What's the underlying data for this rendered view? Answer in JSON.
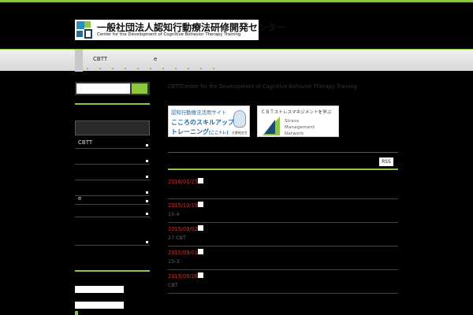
{
  "logo": {
    "title": "一般社団法人認知行動療法研修開発センター",
    "subtitle": "Center for the Development of Cognitive Behavior Therapy Training"
  },
  "nav": {
    "items": [
      "CBTT",
      "e"
    ]
  },
  "sidebar": {
    "rows": [
      "CBTT",
      "",
      "",
      "",
      "e",
      "",
      ""
    ]
  },
  "main": {
    "title": "CBTTCenter for the Development of Cognitive Behavior Therapy Training"
  },
  "banners": {
    "b1_line1": "認知行動療法活用サイト",
    "b1_line2": "こころのスキルアップ・",
    "b1_line3": "トレーニング",
    "b1_line3_small": "[ここトレ]",
    "b1_name": "大野裕先生",
    "b2_title": "ＣＢＴストレスマネジメントを学ぶ",
    "b2_words": [
      "Stress",
      "Management",
      "Network"
    ]
  },
  "rss": "RSS",
  "news": [
    {
      "date": "2016/01/25",
      "text": ""
    },
    {
      "date": "2015/10/19",
      "text": "15-4"
    },
    {
      "date": "2015/09/02",
      "text": "27 CBT"
    },
    {
      "date": "2015/09/01",
      "text": "15-3"
    },
    {
      "date": "2015/08/26",
      "text": "CBT"
    }
  ]
}
